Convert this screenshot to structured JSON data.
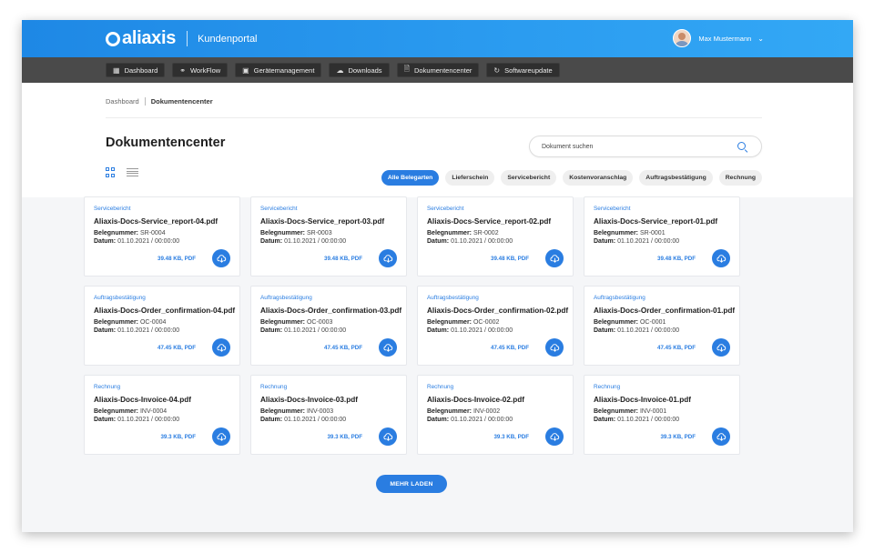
{
  "header": {
    "brand": "aliaxis",
    "portal": "Kundenportal",
    "user_name": "Max Mustermann"
  },
  "nav": [
    {
      "label": "Dashboard",
      "icon": "grid-icon"
    },
    {
      "label": "WorkFlow",
      "icon": "workflow-icon"
    },
    {
      "label": "Gerätemanagement",
      "icon": "device-icon"
    },
    {
      "label": "Downloads",
      "icon": "cloud-download-icon"
    },
    {
      "label": "Dokumentencenter",
      "icon": "document-icon"
    },
    {
      "label": "Softwareupdate",
      "icon": "refresh-icon"
    }
  ],
  "breadcrumb": {
    "root": "Dashboard",
    "current": "Dokumentencenter"
  },
  "page": {
    "title": "Dokumentencenter"
  },
  "search": {
    "placeholder": "Dokument suchen"
  },
  "filters": [
    "Alle Belegarten",
    "Lieferschein",
    "Servicebericht",
    "Kostenvoranschlag",
    "Auftragsbestätigung",
    "Rechnung"
  ],
  "active_filter": "Alle Belegarten",
  "labels": {
    "belegnummer": "Belegnummer:",
    "datum": "Datum:"
  },
  "cards": [
    {
      "type": "Servicebericht",
      "name": "Aliaxis-Docs-Service_report-04.pdf",
      "number": "SR-0004",
      "date": "01.10.2021 / 00:00:00",
      "size": "39.48 KB, PDF"
    },
    {
      "type": "Servicebericht",
      "name": "Aliaxis-Docs-Service_report-03.pdf",
      "number": "SR-0003",
      "date": "01.10.2021 / 00:00:00",
      "size": "39.48 KB, PDF"
    },
    {
      "type": "Servicebericht",
      "name": "Aliaxis-Docs-Service_report-02.pdf",
      "number": "SR-0002",
      "date": "01.10.2021 / 00:00:00",
      "size": "39.48 KB, PDF"
    },
    {
      "type": "Servicebericht",
      "name": "Aliaxis-Docs-Service_report-01.pdf",
      "number": "SR-0001",
      "date": "01.10.2021 / 00:00:00",
      "size": "39.48 KB, PDF"
    },
    {
      "type": "Auftragsbestätigung",
      "name": "Aliaxis-Docs-Order_confirmation-04.pdf",
      "number": "OC-0004",
      "date": "01.10.2021 / 00:00:00",
      "size": "47.45 KB, PDF"
    },
    {
      "type": "Auftragsbestätigung",
      "name": "Aliaxis-Docs-Order_confirmation-03.pdf",
      "number": "OC-0003",
      "date": "01.10.2021 / 00:00:00",
      "size": "47.45 KB, PDF"
    },
    {
      "type": "Auftragsbestätigung",
      "name": "Aliaxis-Docs-Order_confirmation-02.pdf",
      "number": "OC-0002",
      "date": "01.10.2021 / 00:00:00",
      "size": "47.45 KB, PDF"
    },
    {
      "type": "Auftragsbestätigung",
      "name": "Aliaxis-Docs-Order_confirmation-01.pdf",
      "number": "OC-0001",
      "date": "01.10.2021 / 00:00:00",
      "size": "47.45 KB, PDF"
    },
    {
      "type": "Rechnung",
      "name": "Aliaxis-Docs-Invoice-04.pdf",
      "number": "INV-0004",
      "date": "01.10.2021 / 00:00:00",
      "size": "39.3 KB, PDF"
    },
    {
      "type": "Rechnung",
      "name": "Aliaxis-Docs-Invoice-03.pdf",
      "number": "INV-0003",
      "date": "01.10.2021 / 00:00:00",
      "size": "39.3 KB, PDF"
    },
    {
      "type": "Rechnung",
      "name": "Aliaxis-Docs-Invoice-02.pdf",
      "number": "INV-0002",
      "date": "01.10.2021 / 00:00:00",
      "size": "39.3 KB, PDF"
    },
    {
      "type": "Rechnung",
      "name": "Aliaxis-Docs-Invoice-01.pdf",
      "number": "INV-0001",
      "date": "01.10.2021 / 00:00:00",
      "size": "39.3 KB, PDF"
    }
  ],
  "load_more": "MEHR LADEN",
  "colors": {
    "accent": "#2a7de1",
    "header_gradient_start": "#1e88e5",
    "header_gradient_end": "#33a8f5",
    "nav_bg": "#4a4a4a"
  }
}
